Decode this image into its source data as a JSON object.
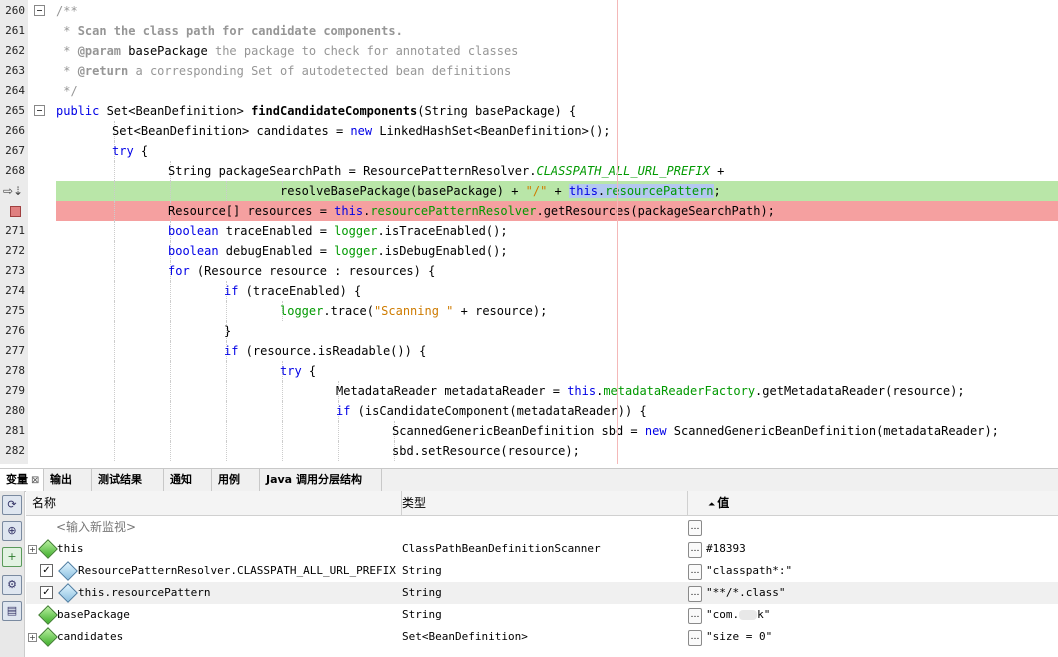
{
  "editor": {
    "lines": [
      {
        "num": "260",
        "fold": true,
        "indent": 0,
        "segments": [
          {
            "t": "/**",
            "c": "cm"
          }
        ]
      },
      {
        "num": "261",
        "indent": 0,
        "segments": [
          {
            "t": " * ",
            "c": "cm"
          },
          {
            "t": "Scan the class path for candidate components.",
            "c": "cmb"
          }
        ]
      },
      {
        "num": "262",
        "indent": 0,
        "segments": [
          {
            "t": " * ",
            "c": "cm"
          },
          {
            "t": "@param",
            "c": "cmb"
          },
          {
            "t": " basePackage ",
            "c": ""
          },
          {
            "t": "the package to check for annotated classes",
            "c": "cm"
          }
        ]
      },
      {
        "num": "263",
        "indent": 0,
        "segments": [
          {
            "t": " * ",
            "c": "cm"
          },
          {
            "t": "@return",
            "c": "cmb"
          },
          {
            "t": " a corresponding Set of autodetected bean definitions",
            "c": "cm"
          }
        ]
      },
      {
        "num": "264",
        "indent": 0,
        "segments": [
          {
            "t": " */",
            "c": "cm"
          }
        ]
      },
      {
        "num": "265",
        "fold": true,
        "indent": 0,
        "segments": [
          {
            "t": "public",
            "c": "kw"
          },
          {
            "t": " Set<BeanDefinition> ",
            "c": ""
          },
          {
            "t": "findCandidateComponents",
            "c": "bold"
          },
          {
            "t": "(String basePackage) {",
            "c": ""
          }
        ]
      },
      {
        "num": "266",
        "indent": 1,
        "segments": [
          {
            "t": "Set<BeanDefinition> candidates = ",
            "c": ""
          },
          {
            "t": "new",
            "c": "kw"
          },
          {
            "t": " LinkedHashSet<BeanDefinition>();",
            "c": ""
          }
        ]
      },
      {
        "num": "267",
        "indent": 1,
        "segments": [
          {
            "t": "try",
            "c": "kw"
          },
          {
            "t": " {",
            "c": ""
          }
        ]
      },
      {
        "num": "268",
        "indent": 2,
        "segments": [
          {
            "t": "String packageSearchPath = ResourcePatternResolver.",
            "c": ""
          },
          {
            "t": "CLASSPATH_ALL_URL_PREFIX",
            "c": "fldi"
          },
          {
            "t": " +",
            "c": ""
          }
        ]
      },
      {
        "num": "",
        "marker": "arrow",
        "hl": "green",
        "indent": 4,
        "segments": [
          {
            "t": "resolveBasePackage(basePackage) + ",
            "c": ""
          },
          {
            "t": "\"/\"",
            "c": "str"
          },
          {
            "t": " + ",
            "c": ""
          },
          {
            "t": "this",
            "c": "kw sel"
          },
          {
            "t": ".",
            "c": "sel"
          },
          {
            "t": "resourcePattern",
            "c": "fld sel"
          },
          {
            "t": ";",
            "c": ""
          }
        ]
      },
      {
        "num": "",
        "marker": "breakpoint",
        "hl": "red",
        "indent": 2,
        "segments": [
          {
            "t": "Resource[] resources = ",
            "c": ""
          },
          {
            "t": "this",
            "c": "kw"
          },
          {
            "t": ".",
            "c": ""
          },
          {
            "t": "resourcePatternResolver",
            "c": "fld"
          },
          {
            "t": ".getResources(packageSearchPath);",
            "c": ""
          }
        ]
      },
      {
        "num": "271",
        "indent": 2,
        "segments": [
          {
            "t": "boolean",
            "c": "kw"
          },
          {
            "t": " traceEnabled = ",
            "c": ""
          },
          {
            "t": "logger",
            "c": "fld"
          },
          {
            "t": ".isTraceEnabled();",
            "c": ""
          }
        ]
      },
      {
        "num": "272",
        "indent": 2,
        "segments": [
          {
            "t": "boolean",
            "c": "kw"
          },
          {
            "t": " debugEnabled = ",
            "c": ""
          },
          {
            "t": "logger",
            "c": "fld"
          },
          {
            "t": ".isDebugEnabled();",
            "c": ""
          }
        ]
      },
      {
        "num": "273",
        "indent": 2,
        "segments": [
          {
            "t": "for",
            "c": "kw"
          },
          {
            "t": " (Resource resource : resources) {",
            "c": ""
          }
        ]
      },
      {
        "num": "274",
        "indent": 3,
        "segments": [
          {
            "t": "if",
            "c": "kw"
          },
          {
            "t": " (traceEnabled) {",
            "c": ""
          }
        ]
      },
      {
        "num": "275",
        "indent": 4,
        "segments": [
          {
            "t": "logger",
            "c": "fld"
          },
          {
            "t": ".trace(",
            "c": ""
          },
          {
            "t": "\"Scanning \"",
            "c": "str"
          },
          {
            "t": " + resource);",
            "c": ""
          }
        ]
      },
      {
        "num": "276",
        "indent": 3,
        "segments": [
          {
            "t": "}",
            "c": ""
          }
        ]
      },
      {
        "num": "277",
        "indent": 3,
        "segments": [
          {
            "t": "if",
            "c": "kw"
          },
          {
            "t": " (resource.isReadable()) {",
            "c": ""
          }
        ]
      },
      {
        "num": "278",
        "indent": 4,
        "segments": [
          {
            "t": "try",
            "c": "kw"
          },
          {
            "t": " {",
            "c": ""
          }
        ]
      },
      {
        "num": "279",
        "indent": 5,
        "segments": [
          {
            "t": "MetadataReader metadataReader = ",
            "c": ""
          },
          {
            "t": "this",
            "c": "kw"
          },
          {
            "t": ".",
            "c": ""
          },
          {
            "t": "metadataReaderFactory",
            "c": "fld"
          },
          {
            "t": ".getMetadataReader(resource);",
            "c": ""
          }
        ]
      },
      {
        "num": "280",
        "indent": 5,
        "segments": [
          {
            "t": "if",
            "c": "kw"
          },
          {
            "t": " (isCandidateComponent(metadataReader)) {",
            "c": ""
          }
        ]
      },
      {
        "num": "281",
        "indent": 6,
        "segments": [
          {
            "t": "ScannedGenericBeanDefinition sbd = ",
            "c": ""
          },
          {
            "t": "new",
            "c": "kw"
          },
          {
            "t": " ScannedGenericBeanDefinition(metadataReader);",
            "c": ""
          }
        ]
      },
      {
        "num": "282",
        "indent": 6,
        "segments": [
          {
            "t": "sbd.setResource(resource);",
            "c": ""
          }
        ]
      }
    ]
  },
  "tabs": [
    {
      "label": "变量",
      "active": true,
      "close": "⊠"
    },
    {
      "label": "输出"
    },
    {
      "label": "测试结果"
    },
    {
      "label": "通知"
    },
    {
      "label": "用例"
    },
    {
      "label": "Java 调用分层结构"
    }
  ],
  "variables": {
    "headers": {
      "name": "名称",
      "type": "类型",
      "value": "值",
      "sort_marker": "⏶"
    },
    "new_watch_placeholder": "<输入新监视>",
    "rows": [
      {
        "expand": true,
        "check": false,
        "icon": "green-gem-icon",
        "name": "this",
        "type": "ClassPathBeanDefinitionScanner",
        "value": "#18393"
      },
      {
        "expand": false,
        "check": true,
        "icon": "blue-gem-icon",
        "name": "ResourcePatternResolver.CLASSPATH_ALL_URL_PREFIX",
        "type": "String",
        "value": "\"classpath*:\""
      },
      {
        "expand": false,
        "check": true,
        "icon": "blue-gem-icon",
        "name": "this.resourcePattern",
        "type": "String",
        "value": "\"**/*.class\""
      },
      {
        "expand": false,
        "check": false,
        "icon": "green-gem-icon",
        "name": "basePackage",
        "type": "String",
        "value_prefix": "\"com.",
        "value_suffix": "k\""
      },
      {
        "expand": true,
        "check": false,
        "icon": "green-gem-icon",
        "name": "candidates",
        "type": "Set<BeanDefinition>",
        "value": "\"size = 0\""
      }
    ]
  },
  "colors": {
    "keyword": "#0000e6",
    "field": "#009900",
    "comment": "#969696",
    "string": "#ce7b00",
    "current_line": "#b9e6a8",
    "breakpoint_line": "#f5a0a0"
  }
}
